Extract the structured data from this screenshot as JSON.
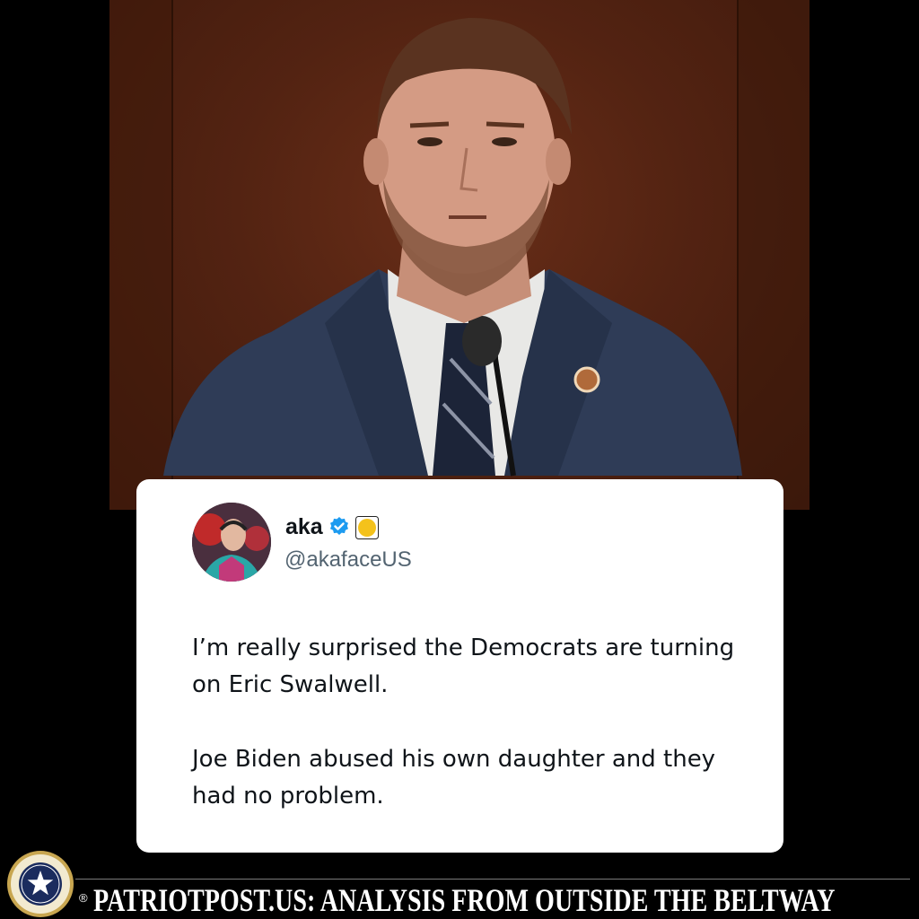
{
  "tweet": {
    "display_name": "aka",
    "handle": "@akafaceUS",
    "paragraphs": [
      "I’m really surprised the Democrats are turning on Eric Swalwell.",
      "Joe Biden abused his own daughter and they had no problem."
    ],
    "verified_icon": "verified-badge-icon",
    "extra_badge_icon": "yellow-circle-badge-icon",
    "colors": {
      "verified": "#1d9bf0",
      "badge": "#f4c21b",
      "text": "#0f1419",
      "handle": "#536471"
    }
  },
  "footer": {
    "text": "PATRIOTPOST.US: ANALYSIS FROM OUTSIDE THE BELTWAY",
    "registered": "®",
    "seal_icon": "patriot-post-seal-icon"
  },
  "photo": {
    "subject": "man-in-suit-photo"
  }
}
